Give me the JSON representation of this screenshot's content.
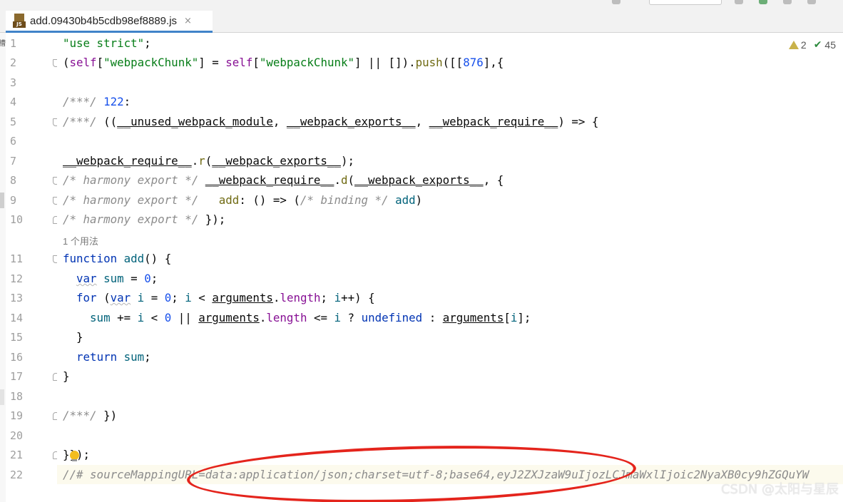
{
  "tab": {
    "title": "add.09430b4b5cdb98ef8889.js",
    "icon": "js-file-icon",
    "close_glyph": "×"
  },
  "inspections": {
    "warnings": "2",
    "ok_count": "45"
  },
  "line_numbers": [
    "1",
    "2",
    "3",
    "4",
    "5",
    "6",
    "7",
    "8",
    "9",
    "10",
    "11",
    "12",
    "13",
    "14",
    "15",
    "16",
    "17",
    "18",
    "19",
    "20",
    "21",
    "22"
  ],
  "inlay_usages": "1 个用法",
  "code": {
    "l1_str": "\"use strict\"",
    "l1_semi": ";",
    "l2_open": "(",
    "l2_self1": "self",
    "l2_b1": "[",
    "l2_str1": "\"webpackChunk\"",
    "l2_mid": "] = ",
    "l2_self2": "self",
    "l2_b2": "[",
    "l2_str2": "\"webpackChunk\"",
    "l2_or": "] || []).",
    "l2_push": "push",
    "l2_args": "([[",
    "l2_num": "876",
    "l2_end": "],{",
    "l4_cm": "/***/",
    "l4_num": " 122",
    "l4_colon": ":",
    "l5_cm": "/***/",
    "l5_a": " ((",
    "l5_p1": "__unused_webpack_module",
    "l5_c1": ", ",
    "l5_p2": "__webpack_exports__",
    "l5_c2": ", ",
    "l5_p3": "__webpack_require__",
    "l5_end": ") => {",
    "l7_req": "__webpack_require__",
    "l7_dot": ".",
    "l7_r": "r",
    "l7_o": "(",
    "l7_exp": "__webpack_exports__",
    "l7_end": ");",
    "l8_cm": "/* harmony export */",
    "l8_sp": " ",
    "l8_req": "__webpack_require__",
    "l8_dot": ".",
    "l8_d": "d",
    "l8_o": "(",
    "l8_exp": "__webpack_exports__",
    "l8_end": ", {",
    "l9_cm": "/* harmony export */",
    "l9_sp": "   ",
    "l9_add": "add",
    "l9_mid": ": () => (",
    "l9_cm2": "/* binding */",
    "l9_sp2": " ",
    "l9_fn": "add",
    "l9_end": ")",
    "l10_cm": "/* harmony export */",
    "l10_end": " });",
    "l11_kw": "function",
    "l11_sp": " ",
    "l11_fn": "add",
    "l11_end": "() {",
    "l12_ind": "  ",
    "l12_kw": "var",
    "l12_sp": " ",
    "l12_v": "sum",
    "l12_eq": " = ",
    "l12_num": "0",
    "l12_end": ";",
    "l13_ind": "  ",
    "l13_kw": "for",
    "l13_o": " (",
    "l13_kw2": "var",
    "l13_sp": " ",
    "l13_i": "i",
    "l13_eq": " = ",
    "l13_num": "0",
    "l13_s1": "; ",
    "l13_i2": "i",
    "l13_lt": " < ",
    "l13_args": "arguments",
    "l13_dot": ".",
    "l13_len": "length",
    "l13_s2": "; ",
    "l13_i3": "i",
    "l13_end": "++) {",
    "l14_ind": "    ",
    "l14_sum": "sum",
    "l14_pe": " += ",
    "l14_i": "i",
    "l14_lt": " < ",
    "l14_num": "0",
    "l14_or": " || ",
    "l14_args": "arguments",
    "l14_dot": ".",
    "l14_len": "length",
    "l14_le": " <= ",
    "l14_i2": "i",
    "l14_q": " ? ",
    "l14_und": "undefined",
    "l14_c": " : ",
    "l14_args2": "arguments",
    "l14_br": "[",
    "l14_i3": "i",
    "l14_end": "];",
    "l15": "  }",
    "l16_ind": "  ",
    "l16_kw": "return",
    "l16_sp": " ",
    "l16_v": "sum",
    "l16_end": ";",
    "l17": "}",
    "l19_cm": "/***/",
    "l19_end": " })",
    "l21": "}});",
    "l22_cm": "//# sourceMappingURL=data:application/json;charset=utf-8;base64,eyJ2ZXJzaW9uIjozLCJmaWxlIjoic2NyaXB0cy9hZGQuYW"
  },
  "watermark": "CSDN @太阳与星辰"
}
